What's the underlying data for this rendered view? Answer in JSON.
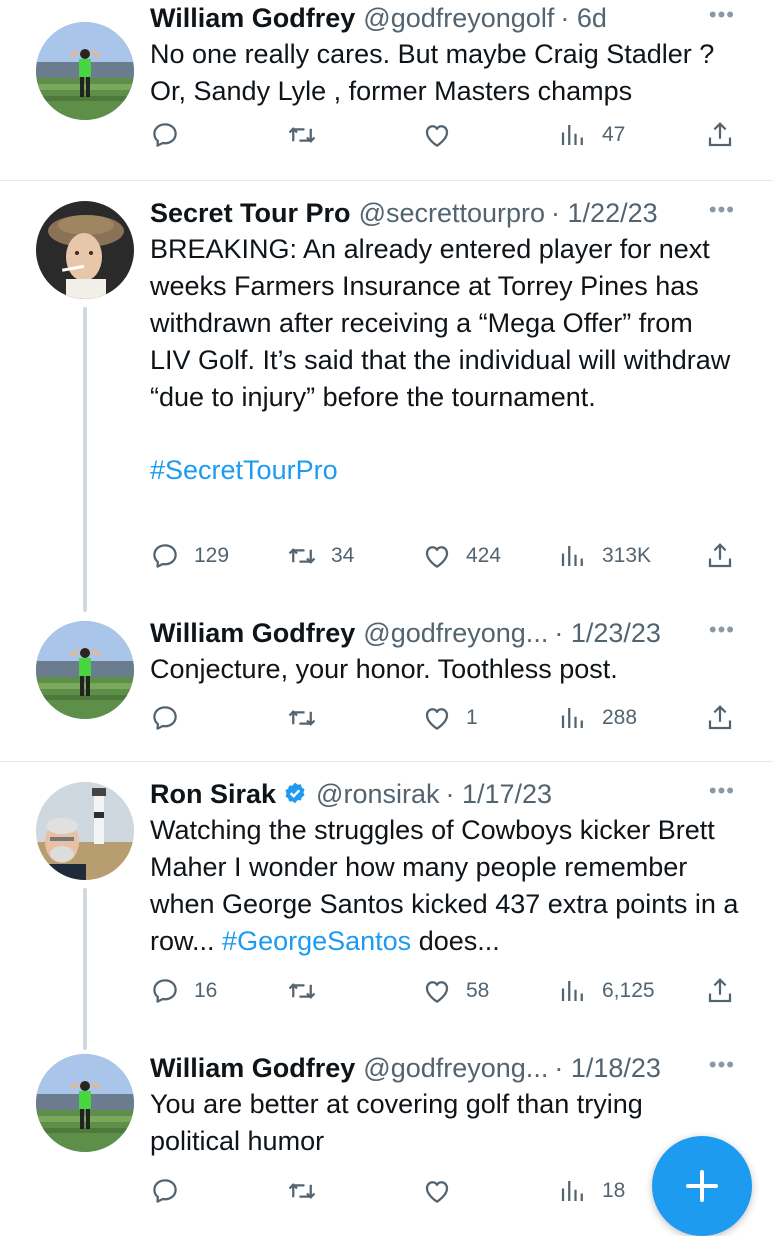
{
  "tweets": [
    {
      "name": "William Godfrey",
      "handle": "@godfreyongolf",
      "date": "· 6d",
      "text": "No one really cares. But maybe Craig Stadler ? Or, Sandy Lyle , former Masters champs",
      "replies": "",
      "retweets": "",
      "likes": "",
      "views": "47"
    },
    {
      "name": "Secret Tour Pro",
      "handle": "@secrettourpro",
      "date": "· 1/22/23",
      "text": "BREAKING: An already entered player for next weeks Farmers Insurance at Torrey Pines has withdrawn after receiving a “Mega Offer” from LIV Golf. It’s said that the individual will withdraw “due to injury” before the tournament.",
      "hashtag": "#SecretTourPro",
      "replies": "129",
      "retweets": "34",
      "likes": "424",
      "views": "313K"
    },
    {
      "name": "William Godfrey",
      "handle": "@godfreyong...",
      "date": "· 1/23/23",
      "text": "Conjecture, your honor. Toothless post.",
      "replies": "",
      "retweets": "",
      "likes": "1",
      "views": "288"
    },
    {
      "name": "Ron Sirak",
      "handle": "@ronsirak",
      "date": "· 1/17/23",
      "text": "Watching the struggles of Cowboys kicker Brett Maher I wonder how many people remember when George Santos kicked 437 extra points in a row...",
      "hashtag": "#GeorgeSantos",
      "text_tail": "does...",
      "replies": "16",
      "retweets": "",
      "likes": "58",
      "views": "6,125"
    },
    {
      "name": "William Godfrey",
      "handle": "@godfreyong...",
      "date": "· 1/18/23",
      "text": "You are better at covering golf than trying political humor",
      "replies": "",
      "retweets": "",
      "likes": "",
      "views": "18"
    }
  ],
  "more_label": "•••",
  "colors": {
    "accent": "#1d9bf0",
    "muted": "#536471",
    "text": "#0f1419"
  },
  "icons": [
    "reply-icon",
    "retweet-icon",
    "like-icon",
    "views-icon",
    "share-icon",
    "verified-icon",
    "compose-icon"
  ]
}
